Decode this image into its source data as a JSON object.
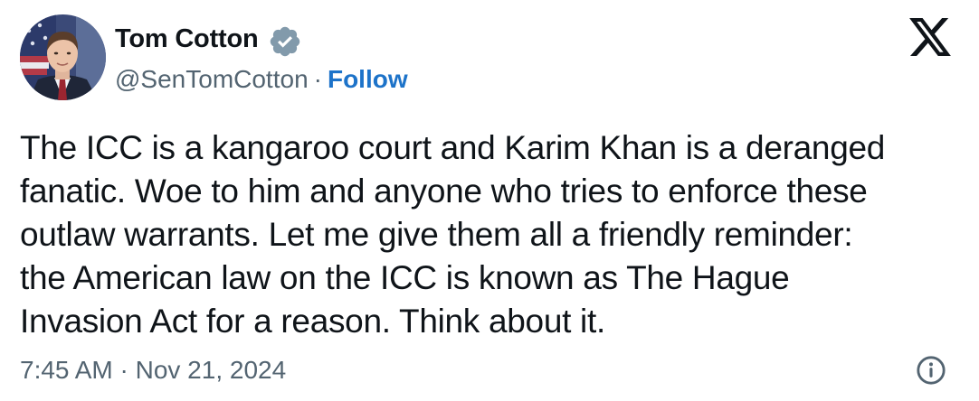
{
  "author": {
    "display_name": "Tom Cotton",
    "handle": "@SenTomCotton",
    "separator": "·",
    "follow_label": "Follow",
    "verified_color": "#829aab"
  },
  "tweet": {
    "text_lines": [
      "The ICC is a kangaroo court and Karim Khan is a deranged",
      "fanatic. Woe to him and anyone who tries to enforce these",
      "outlaw warrants. Let me give them all a friendly reminder:",
      "the American law on the ICC is known as The Hague",
      "Invasion Act for a reason. Think about it."
    ],
    "timestamp": "7:45 AM · Nov 21, 2024"
  },
  "icons": {
    "platform_logo": "x-logo-icon",
    "info": "info-icon",
    "verified": "verified-badge-icon"
  },
  "colors": {
    "text": "#0f1419",
    "secondary_text": "#536471",
    "follow_link": "#1d73c9",
    "background": "#ffffff"
  }
}
